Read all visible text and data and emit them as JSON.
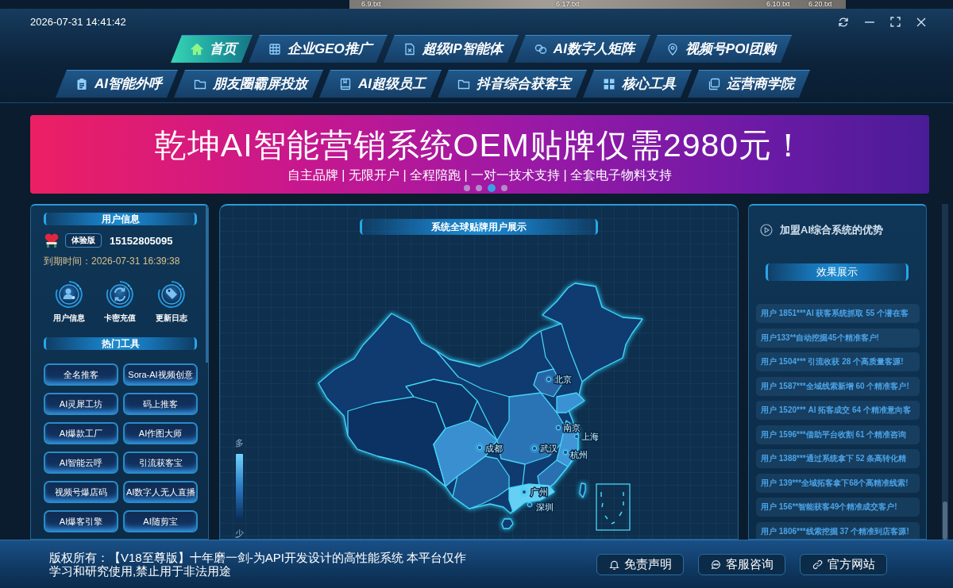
{
  "desktop": {
    "file_labels": [
      "6.9.txt",
      "6.17.txt",
      "6.10.txt",
      "6.20.txt"
    ]
  },
  "title_bar": {
    "datetime": "2026-07-31 14:41:42"
  },
  "nav_rows": [
    {
      "tabs": [
        {
          "label": "首页",
          "selected": true
        },
        {
          "label": "企业GEO推广",
          "selected": false
        },
        {
          "label": "超级IP智能体",
          "selected": false
        },
        {
          "label": "AI数字人矩阵",
          "selected": false
        },
        {
          "label": "视频号POI团购",
          "selected": false
        }
      ]
    },
    {
      "tabs": [
        {
          "label": "AI智能外呼",
          "selected": false
        },
        {
          "label": "朋友圈霸屏投放",
          "selected": false
        },
        {
          "label": "AI超级员工",
          "selected": false
        },
        {
          "label": "抖音综合获客宝",
          "selected": false
        },
        {
          "label": "核心工具",
          "selected": false
        },
        {
          "label": "运营商学院",
          "selected": false
        }
      ]
    }
  ],
  "banner": {
    "title": "乾坤AI智能营销系统OEM贴牌仅需2980元！",
    "subtitle": "自主品牌 | 无限开户 | 全程陪跑 | 一对一技术支持 | 全套电子物料支持",
    "dots": [
      {
        "selected": false
      },
      {
        "selected": false
      },
      {
        "selected": true
      },
      {
        "selected": false
      }
    ]
  },
  "user_panel": {
    "title": "用户信息",
    "badge": "体验版",
    "phone": "15152805095",
    "expiry": "到期时间：2026-07-31 16:39:38",
    "shortcuts": [
      {
        "label": "用户信息"
      },
      {
        "label": "卡密充值"
      },
      {
        "label": "更新日志"
      }
    ],
    "tools_title": "热门工具",
    "tools": [
      "全名推客",
      "Sora-AI视频创意",
      "AI灵犀工坊",
      "码上推客",
      "AI爆款工厂",
      "AI作图大师",
      "AI智能云呼",
      "引流获客宝",
      "视频号爆店码",
      "AI数字人无人直播",
      "AI爆客引擎",
      "AI随剪宝"
    ]
  },
  "map_panel": {
    "title": "系统全球贴牌用户展示",
    "cities": [
      {
        "name": "北京"
      },
      {
        "name": "南京"
      },
      {
        "name": "上海"
      },
      {
        "name": "成都"
      },
      {
        "name": "武汉"
      },
      {
        "name": "杭州"
      },
      {
        "name": "广州"
      },
      {
        "name": "深圳"
      }
    ],
    "legend": {
      "high": "多",
      "low": "少"
    }
  },
  "results_panel": {
    "heading": "加盟AI综合系统的优势",
    "title": "效果展示",
    "items": [
      "用户 1851***AI 获客系统抓取 55 个潜在客",
      "用户133**自动挖掘45个精准客户!",
      "用户 1504*** 引流收获 28 个高质量客源!",
      "用户 1587***全域线索新增 60 个精准客户!",
      "用户 1520*** AI 拓客成交 64 个精准意向客",
      "用户 1596***借助平台收割 61 个精准咨询",
      "用户 1388***通过系统拿下 52 条高转化精",
      "用户 139***全域拓客拿下68个高精准线索!",
      "用户 156**智能获客49个精准成交客户!",
      "用户 1806***线索挖掘 37 个精准到店客源!"
    ]
  },
  "footer": {
    "copyright": "版权所有：【V18至尊版】十年磨一剑-为API开发设计的高性能系统 本平台仅作学习和研究使用,禁止用于非法用途",
    "buttons": [
      "免责声明",
      "客服咨询",
      "官方网站"
    ]
  }
}
